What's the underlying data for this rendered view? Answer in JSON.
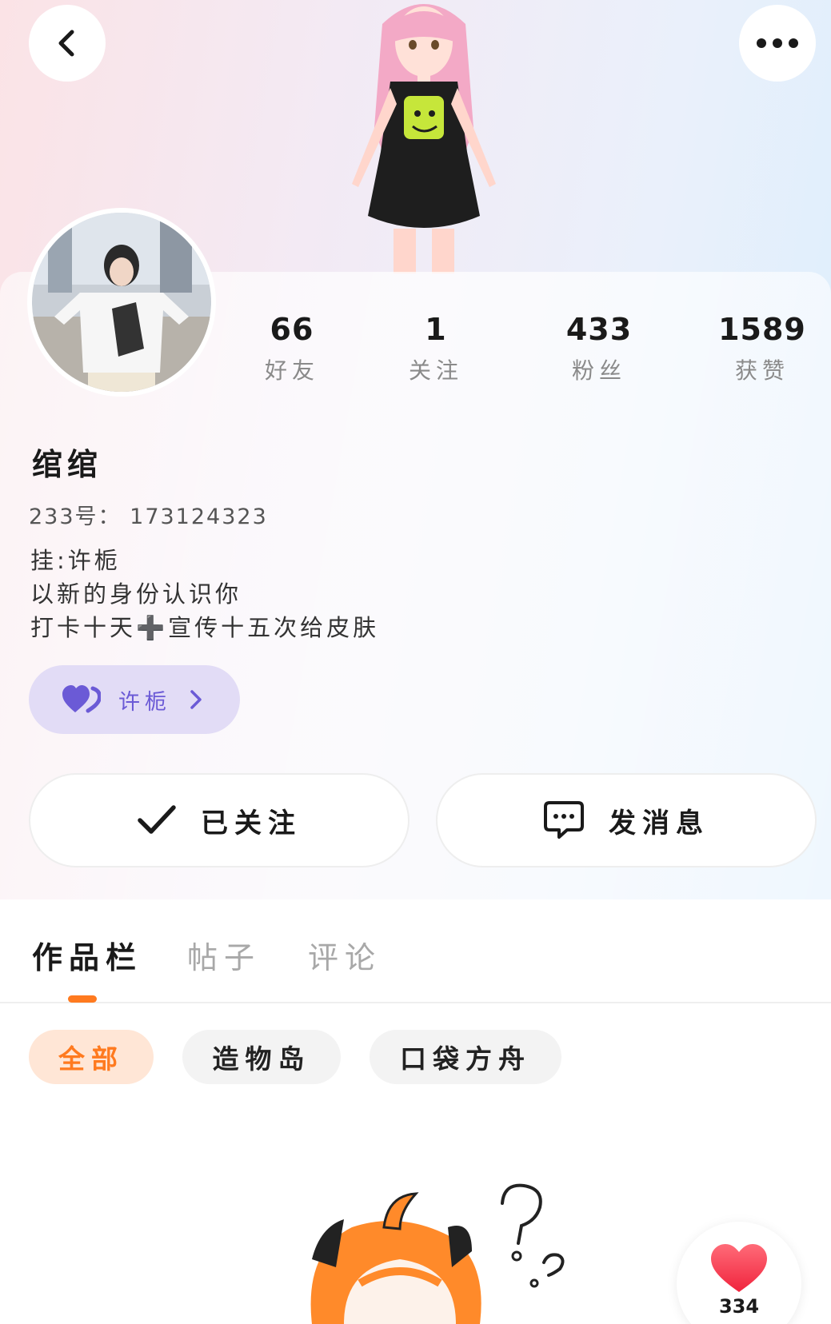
{
  "header": {
    "back_icon": "chevron-left-icon",
    "more_icon": "more-dots-icon"
  },
  "profile": {
    "username": "绾绾",
    "uid_label": "233号：",
    "uid": "173124323",
    "bio_lines": [
      "挂:许栀",
      "以新的身份认识你",
      "打卡十天➕宣传十五次给皮肤"
    ],
    "tag": {
      "label": "许栀",
      "icon": "heart-pair-icon",
      "color": "#6b5ad6"
    }
  },
  "stats": [
    {
      "value": "66",
      "label": "好友"
    },
    {
      "value": "1",
      "label": "关注"
    },
    {
      "value": "433",
      "label": "粉丝"
    },
    {
      "value": "1589",
      "label": "获赞"
    }
  ],
  "actions": {
    "follow_label": "已关注",
    "message_label": "发消息"
  },
  "tabs": [
    {
      "label": "作品栏",
      "active": true
    },
    {
      "label": "帖子",
      "active": false
    },
    {
      "label": "评论",
      "active": false
    }
  ],
  "filters": [
    {
      "label": "全部",
      "active": true
    },
    {
      "label": "造物岛",
      "active": false
    },
    {
      "label": "口袋方舟",
      "active": false
    }
  ],
  "like_fab": {
    "count": "334",
    "icon": "heart-icon"
  },
  "colors": {
    "accent": "#ff7a1f",
    "tag_purple": "#6b5ad6",
    "heart_red": "#ff3b4f"
  }
}
